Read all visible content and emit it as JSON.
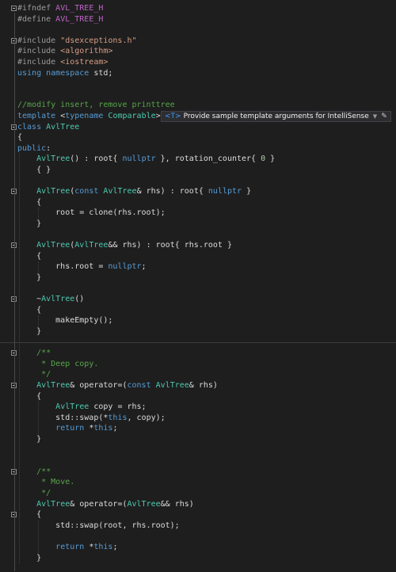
{
  "editor": {
    "lines": [
      [
        [
          "pp",
          "#ifndef "
        ],
        [
          "macro",
          "AVL_TREE_H"
        ]
      ],
      [
        [
          "pp",
          "#define "
        ],
        [
          "macro",
          "AVL_TREE_H"
        ]
      ],
      [],
      [
        [
          "pp",
          "#include "
        ],
        [
          "str",
          "\"dsexceptions.h\""
        ]
      ],
      [
        [
          "pp",
          "#include "
        ],
        [
          "str",
          "<algorithm>"
        ]
      ],
      [
        [
          "pp",
          "#include "
        ],
        [
          "str",
          "<iostream>"
        ]
      ],
      [
        [
          "kw",
          "using"
        ],
        [
          "pl",
          " "
        ],
        [
          "kw",
          "namespace"
        ],
        [
          "pl",
          " std;"
        ]
      ],
      [],
      [],
      [
        [
          "cm",
          "//modify insert, remove printtree"
        ]
      ],
      [
        [
          "kw",
          "template"
        ],
        [
          "pl",
          " <"
        ],
        [
          "kw",
          "typename"
        ],
        [
          "pl",
          " "
        ],
        [
          "type",
          "Comparable"
        ],
        [
          "pl",
          ">"
        ]
      ],
      [
        [
          "kw",
          "class"
        ],
        [
          "pl",
          " "
        ],
        [
          "type",
          "AvlTree"
        ]
      ],
      [
        [
          "pl",
          "{"
        ]
      ],
      [
        [
          "kw",
          "public"
        ],
        [
          "pl",
          ":"
        ]
      ],
      [
        [
          "pl",
          "    "
        ],
        [
          "type",
          "AvlTree"
        ],
        [
          "pl",
          "() : root{ "
        ],
        [
          "kw",
          "nullptr"
        ],
        [
          "pl",
          " }, rotation_counter{ "
        ],
        [
          "num",
          "0"
        ],
        [
          "pl",
          " }"
        ]
      ],
      [
        [
          "pl",
          "    { }"
        ]
      ],
      [],
      [
        [
          "pl",
          "    "
        ],
        [
          "type",
          "AvlTree"
        ],
        [
          "pl",
          "("
        ],
        [
          "kw",
          "const"
        ],
        [
          "pl",
          " "
        ],
        [
          "type",
          "AvlTree"
        ],
        [
          "pl",
          "& rhs) : root{ "
        ],
        [
          "kw",
          "nullptr"
        ],
        [
          "pl",
          " }"
        ]
      ],
      [
        [
          "pl",
          "    {"
        ]
      ],
      [
        [
          "pl",
          "        root = clone(rhs.root);"
        ]
      ],
      [
        [
          "pl",
          "    }"
        ]
      ],
      [],
      [
        [
          "pl",
          "    "
        ],
        [
          "type",
          "AvlTree"
        ],
        [
          "pl",
          "("
        ],
        [
          "type",
          "AvlTree"
        ],
        [
          "pl",
          "&& rhs) : root{ rhs.root }"
        ]
      ],
      [
        [
          "pl",
          "    {"
        ]
      ],
      [
        [
          "pl",
          "        rhs.root = "
        ],
        [
          "kw",
          "nullptr"
        ],
        [
          "pl",
          ";"
        ]
      ],
      [
        [
          "pl",
          "    }"
        ]
      ],
      [],
      [
        [
          "pl",
          "    ~"
        ],
        [
          "type",
          "AvlTree"
        ],
        [
          "pl",
          "()"
        ]
      ],
      [
        [
          "pl",
          "    {"
        ]
      ],
      [
        [
          "pl",
          "        makeEmpty();"
        ]
      ],
      [
        [
          "pl",
          "    }"
        ]
      ],
      [],
      [
        [
          "pl",
          "    "
        ],
        [
          "cm",
          "/**"
        ]
      ],
      [
        [
          "pl",
          "    "
        ],
        [
          "cm",
          " * Deep copy."
        ]
      ],
      [
        [
          "pl",
          "    "
        ],
        [
          "cm",
          " */"
        ]
      ],
      [
        [
          "pl",
          "    "
        ],
        [
          "type",
          "AvlTree"
        ],
        [
          "pl",
          "& operator=("
        ],
        [
          "kw",
          "const"
        ],
        [
          "pl",
          " "
        ],
        [
          "type",
          "AvlTree"
        ],
        [
          "pl",
          "& rhs)"
        ]
      ],
      [
        [
          "pl",
          "    {"
        ]
      ],
      [
        [
          "pl",
          "        "
        ],
        [
          "type",
          "AvlTree"
        ],
        [
          "pl",
          " copy = rhs;"
        ]
      ],
      [
        [
          "pl",
          "        std::swap(*"
        ],
        [
          "kw",
          "this"
        ],
        [
          "pl",
          ", copy);"
        ]
      ],
      [
        [
          "pl",
          "        "
        ],
        [
          "kw",
          "return"
        ],
        [
          "pl",
          " *"
        ],
        [
          "kw",
          "this"
        ],
        [
          "pl",
          ";"
        ]
      ],
      [
        [
          "pl",
          "    }"
        ]
      ],
      [],
      [],
      [
        [
          "pl",
          "    "
        ],
        [
          "cm",
          "/**"
        ]
      ],
      [
        [
          "pl",
          "    "
        ],
        [
          "cm",
          " * Move."
        ]
      ],
      [
        [
          "pl",
          "    "
        ],
        [
          "cm",
          " */"
        ]
      ],
      [
        [
          "pl",
          "    "
        ],
        [
          "type",
          "AvlTree"
        ],
        [
          "pl",
          "& operator=("
        ],
        [
          "type",
          "AvlTree"
        ],
        [
          "pl",
          "&& rhs)"
        ]
      ],
      [
        [
          "pl",
          "    {"
        ]
      ],
      [
        [
          "pl",
          "        std::swap(root, rhs.root);"
        ]
      ],
      [],
      [
        [
          "pl",
          "        "
        ],
        [
          "kw",
          "return"
        ],
        [
          "pl",
          " *"
        ],
        [
          "kw",
          "this"
        ],
        [
          "pl",
          ";"
        ]
      ],
      [
        [
          "pl",
          "    }"
        ]
      ]
    ]
  },
  "template_hint": {
    "badge": "<T>",
    "text": "Provide sample template arguments for IntelliSense"
  },
  "colors": {
    "background": "#1e1e1e",
    "keyword": "#569cd6",
    "type": "#4ec9b0",
    "string": "#d69d85",
    "comment": "#57a64a",
    "macro": "#bd63c5"
  }
}
